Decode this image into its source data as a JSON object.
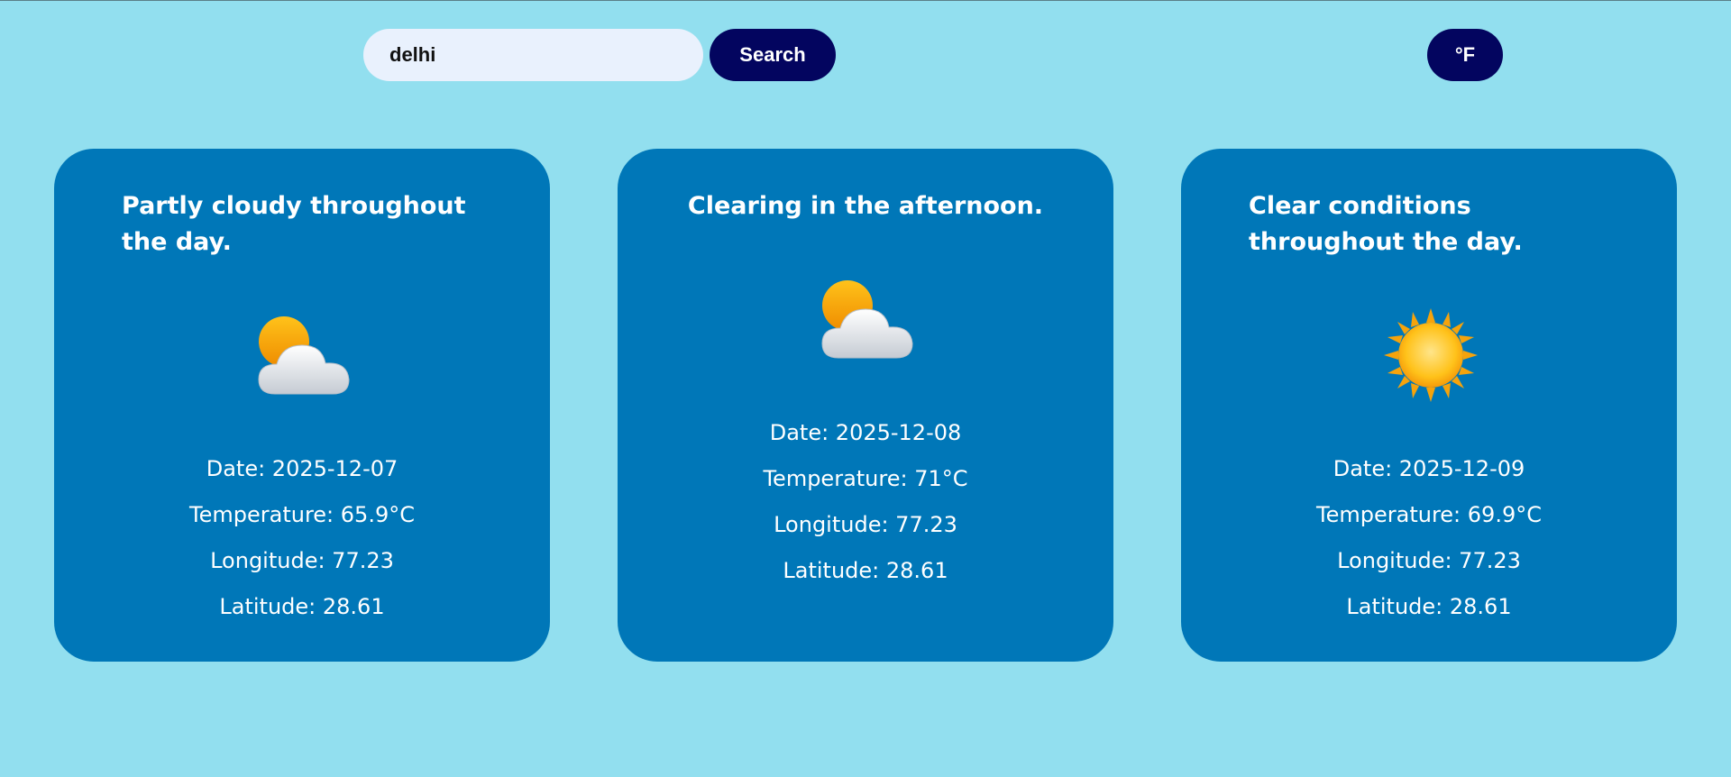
{
  "search": {
    "value": "delhi",
    "button_label": "Search"
  },
  "unit_toggle_label": "°F",
  "colors": {
    "background": "#92dfef",
    "card": "#0077b8",
    "button": "#03055f",
    "input": "#e9f1fd"
  },
  "cards": [
    {
      "title": "Partly cloudy throughout the day.",
      "icon": "partly-cloudy-icon",
      "date": "Date: 2025-12-07",
      "temperature": "Temperature: 65.9°C",
      "longitude": "Longitude: 77.23",
      "latitude": "Latitude: 28.61"
    },
    {
      "title": "Clearing in the afternoon.",
      "icon": "partly-cloudy-icon",
      "date": "Date: 2025-12-08",
      "temperature": "Temperature: 71°C",
      "longitude": "Longitude: 77.23",
      "latitude": "Latitude: 28.61"
    },
    {
      "title": "Clear conditions throughout the day.",
      "icon": "sun-icon",
      "date": "Date: 2025-12-09",
      "temperature": "Temperature: 69.9°C",
      "longitude": "Longitude: 77.23",
      "latitude": "Latitude: 28.61"
    }
  ]
}
